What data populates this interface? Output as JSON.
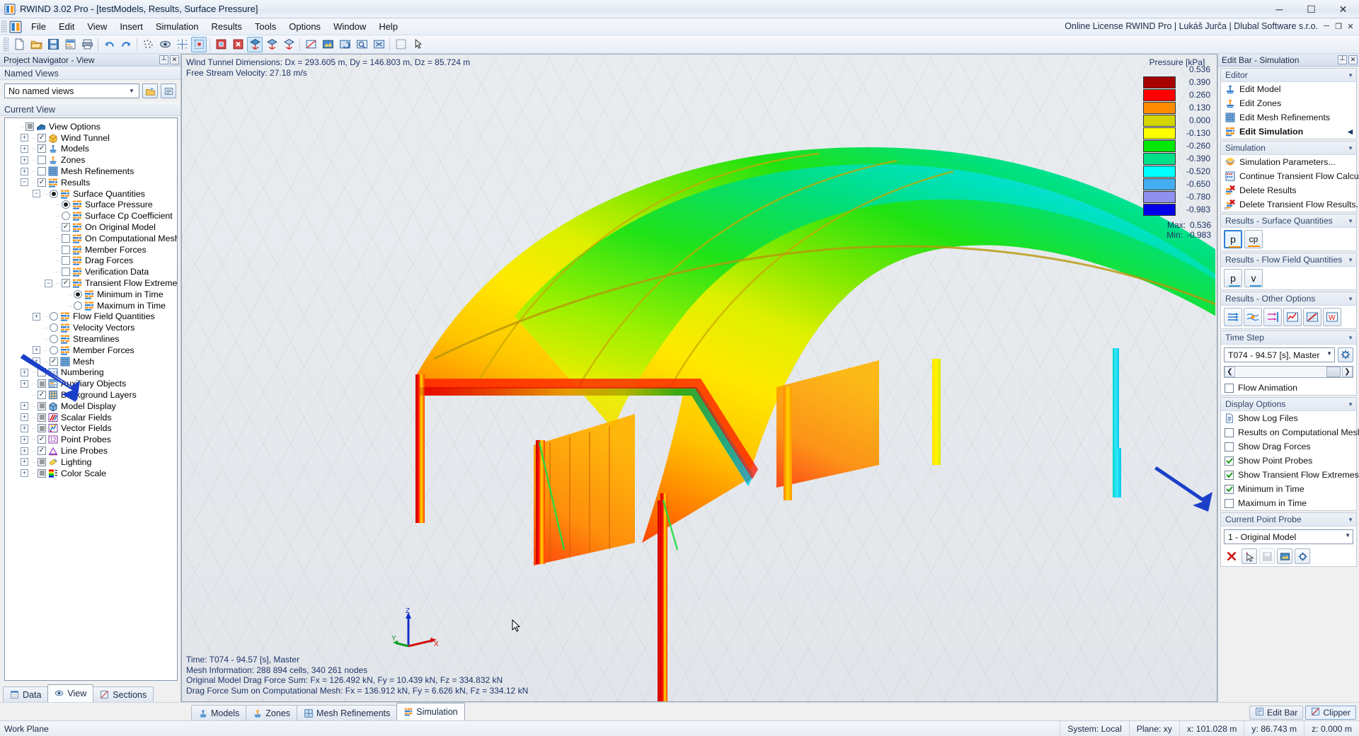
{
  "window": {
    "title": "RWIND 3.02 Pro - [testModels, Results, Surface Pressure]",
    "app_icon": "rwind-icon",
    "minimize": "─",
    "maximize": "☐",
    "close": "✕"
  },
  "menu": {
    "items": [
      "File",
      "Edit",
      "View",
      "Insert",
      "Simulation",
      "Results",
      "Tools",
      "Options",
      "Window",
      "Help"
    ],
    "license": "Online License RWIND Pro | Lukáš Jurča | Dlubal Software s.r.o.",
    "mdi_buttons": [
      "─",
      "❐",
      "✕"
    ]
  },
  "toolbar": {
    "groups": [
      [
        "new-file-icon",
        "open-folder-icon",
        "save-icon",
        "report-icon",
        "print-icon"
      ],
      [
        "undo-icon",
        "redo-icon"
      ],
      [
        "mesh-dots-icon",
        "eye-mesh-icon",
        "snap-grid-icon",
        "select-box-icon"
      ],
      [
        "render-solid-icon",
        "render-x-icon",
        "view-iso1-icon",
        "view-iso2-icon",
        "view-iso3-icon"
      ],
      [
        "view-free-icon",
        "color-render-icon",
        "view-rotate-icon",
        "zoom-window-icon",
        "zoom-fit-icon"
      ],
      [
        "print-area-icon",
        "select-tool-icon"
      ]
    ]
  },
  "left_panel": {
    "header": "Project Navigator - View",
    "header_buttons": [
      "pin-icon",
      "close-icon"
    ],
    "named_views_group": "Named Views",
    "named_views_value": "No named views",
    "named_views_buttons": [
      "save-view-icon",
      "manage-view-icon"
    ],
    "current_view_group": "Current View",
    "tree": [
      {
        "label": "View Options",
        "depth": 0,
        "toggle": "checkbox-gray",
        "expander": "none",
        "icon": "view-options-icon"
      },
      {
        "label": "Wind Tunnel",
        "depth": 1,
        "toggle": "checkbox-checked",
        "expander": "plus",
        "icon": "wind-tunnel-icon"
      },
      {
        "label": "Models",
        "depth": 1,
        "toggle": "checkbox-checked",
        "expander": "plus",
        "icon": "model-icon"
      },
      {
        "label": "Zones",
        "depth": 1,
        "toggle": "checkbox-empty",
        "expander": "plus",
        "icon": "zones-icon"
      },
      {
        "label": "Mesh Refinements",
        "depth": 1,
        "toggle": "checkbox-empty",
        "expander": "plus",
        "icon": "mesh-icon"
      },
      {
        "label": "Results",
        "depth": 1,
        "toggle": "checkbox-checked",
        "expander": "minus",
        "icon": "results-icon"
      },
      {
        "label": "Surface Quantities",
        "depth": 2,
        "toggle": "radio-on",
        "expander": "minus",
        "icon": "results-icon"
      },
      {
        "label": "Surface Pressure",
        "depth": 3,
        "toggle": "radio-on",
        "expander": "none",
        "icon": "results-icon"
      },
      {
        "label": "Surface Cp Coefficient",
        "depth": 3,
        "toggle": "radio-off",
        "expander": "none",
        "icon": "results-icon"
      },
      {
        "label": "On Original Model",
        "depth": 3,
        "toggle": "checkbox-checked",
        "expander": "none",
        "icon": "results-icon"
      },
      {
        "label": "On Computational Mesh",
        "depth": 3,
        "toggle": "checkbox-empty",
        "expander": "none",
        "icon": "results-icon"
      },
      {
        "label": "Member Forces",
        "depth": 3,
        "toggle": "checkbox-empty",
        "expander": "none",
        "icon": "results-icon"
      },
      {
        "label": "Drag Forces",
        "depth": 3,
        "toggle": "checkbox-empty",
        "expander": "none",
        "icon": "results-icon"
      },
      {
        "label": "Verification Data",
        "depth": 3,
        "toggle": "checkbox-empty",
        "expander": "none",
        "icon": "results-icon"
      },
      {
        "label": "Transient Flow Extremes",
        "depth": 3,
        "toggle": "checkbox-checked",
        "expander": "minus",
        "icon": "results-icon"
      },
      {
        "label": "Minimum in Time",
        "depth": 4,
        "toggle": "radio-on",
        "expander": "none",
        "icon": "results-icon"
      },
      {
        "label": "Maximum in Time",
        "depth": 4,
        "toggle": "radio-off",
        "expander": "none",
        "icon": "results-icon"
      },
      {
        "label": "Flow Field Quantities",
        "depth": 2,
        "toggle": "radio-off",
        "expander": "plus",
        "icon": "results-icon"
      },
      {
        "label": "Velocity Vectors",
        "depth": 2,
        "toggle": "radio-off",
        "expander": "none",
        "icon": "results-icon"
      },
      {
        "label": "Streamlines",
        "depth": 2,
        "toggle": "radio-off",
        "expander": "none",
        "icon": "results-icon"
      },
      {
        "label": "Member Forces",
        "depth": 2,
        "toggle": "radio-off",
        "expander": "plus",
        "icon": "results-icon"
      },
      {
        "label": "Mesh",
        "depth": 2,
        "toggle": "checkbox-checked",
        "expander": "plus",
        "icon": "mesh-icon"
      },
      {
        "label": "Numbering",
        "depth": 1,
        "toggle": "checkbox-empty",
        "expander": "plus",
        "icon": "numbering-icon"
      },
      {
        "label": "Auxiliary Objects",
        "depth": 1,
        "toggle": "checkbox-gray",
        "expander": "plus",
        "icon": "auxiliary-icon"
      },
      {
        "label": "Background Layers",
        "depth": 1,
        "toggle": "checkbox-checked",
        "expander": "none",
        "icon": "background-layers-icon"
      },
      {
        "label": "Model Display",
        "depth": 1,
        "toggle": "checkbox-gray",
        "expander": "plus",
        "icon": "model-display-icon"
      },
      {
        "label": "Scalar Fields",
        "depth": 1,
        "toggle": "checkbox-gray",
        "expander": "plus",
        "icon": "scalar-fields-icon"
      },
      {
        "label": "Vector Fields",
        "depth": 1,
        "toggle": "checkbox-gray",
        "expander": "plus",
        "icon": "vector-fields-icon"
      },
      {
        "label": "Point Probes",
        "depth": 1,
        "toggle": "checkbox-checked",
        "expander": "plus",
        "icon": "point-probes-icon"
      },
      {
        "label": "Line Probes",
        "depth": 1,
        "toggle": "checkbox-checked",
        "expander": "plus",
        "icon": "line-probes-icon"
      },
      {
        "label": "Lighting",
        "depth": 1,
        "toggle": "checkbox-gray",
        "expander": "plus",
        "icon": "lighting-icon"
      },
      {
        "label": "Color Scale",
        "depth": 1,
        "toggle": "checkbox-gray",
        "expander": "plus",
        "icon": "color-scale-icon"
      }
    ]
  },
  "view": {
    "top_info": [
      "Wind Tunnel Dimensions: Dx = 293.605 m, Dy = 146.803 m, Dz = 85.724 m",
      "Free Stream Velocity: 27.18 m/s"
    ],
    "bottom_info": [
      "Time: T074 - 94.57 [s], Master",
      "Mesh Information: 288 894 cells, 340 261 nodes",
      "Original Model Drag Force Sum: Fx = 126.492 kN, Fy = 10.439 kN, Fz = 334.832 kN",
      "Drag Force Sum on Computational Mesh: Fx = 136.912 kN, Fy = 6.626 kN, Fz = 334.12 kN"
    ],
    "axes": {
      "x": "X",
      "y": "Y",
      "z": "Z"
    }
  },
  "legend": {
    "title": "Pressure [kPa]",
    "values": [
      "0.536",
      "0.390",
      "0.260",
      "0.130",
      "0.000",
      "-0.130",
      "-0.260",
      "-0.390",
      "-0.520",
      "-0.650",
      "-0.780",
      "-0.983"
    ],
    "colors": [
      "#a80000",
      "#fe0000",
      "#ff8c00",
      "#d4d400",
      "#ffff00",
      "#00e800",
      "#00e08a",
      "#00ffff",
      "#45aef0",
      "#8f90ef",
      "#0000e8"
    ],
    "max_label": "Max:",
    "max_value": "0.536",
    "min_label": "Min:",
    "min_value": "-0.983"
  },
  "right_panel": {
    "header": "Edit Bar - Simulation",
    "header_buttons": [
      "pin-icon",
      "close-icon"
    ],
    "sections": [
      {
        "title": "Editor",
        "items": [
          {
            "label": "Edit Model",
            "icon": "model-icon",
            "bold": false
          },
          {
            "label": "Edit Zones",
            "icon": "zones-icon",
            "bold": false
          },
          {
            "label": "Edit Mesh Refinements",
            "icon": "mesh-icon",
            "bold": false
          },
          {
            "label": "Edit Simulation",
            "icon": "results-icon",
            "bold": true
          }
        ]
      },
      {
        "title": "Simulation",
        "items": [
          {
            "label": "Simulation Parameters...",
            "icon": "sim-params-icon",
            "bold": false
          },
          {
            "label": "Continue Transient Flow Calculat...",
            "icon": "continue-calc-icon",
            "bold": false
          },
          {
            "label": "Delete Results",
            "icon": "delete-results-icon",
            "bold": false
          },
          {
            "label": "Delete Transient Flow Results...",
            "icon": "delete-transient-icon",
            "bold": false
          }
        ]
      }
    ],
    "results_surface": {
      "title": "Results - Surface Quantities",
      "buttons": [
        {
          "label": "p",
          "selected": true,
          "underline": "#ff8c00"
        },
        {
          "label": "cp",
          "selected": false,
          "underline": "#ff8c00"
        }
      ]
    },
    "results_flow": {
      "title": "Results - Flow Field Quantities",
      "buttons": [
        {
          "label": "p",
          "selected": false,
          "underline": "#3a9bd9"
        },
        {
          "label": "v",
          "selected": false,
          "underline": "#3a9bd9"
        }
      ]
    },
    "results_other": {
      "title": "Results - Other Options",
      "buttons": [
        "flow-vectors-icon",
        "streamlines-icon",
        "section-plane-icon",
        "graph-icon",
        "diagram-icon",
        "wind-profile-icon"
      ]
    },
    "time_step": {
      "title": "Time Step",
      "value": "T074 - 94.57 [s], Master",
      "settings_icon": "gear-icon",
      "prev": "❮",
      "next": "❯",
      "flow_animation": {
        "label": "Flow Animation",
        "checked": false
      }
    },
    "display_options": {
      "title": "Display Options",
      "items": [
        {
          "label": "Show Log Files",
          "type": "doc-icon",
          "checked": false
        },
        {
          "label": "Results on Computational Mesh",
          "type": "checkbox",
          "checked": false
        },
        {
          "label": "Show Drag Forces",
          "type": "checkbox",
          "checked": false
        },
        {
          "label": "Show Point Probes",
          "type": "checkbox",
          "checked": true
        },
        {
          "label": "Show Transient Flow Extremes",
          "type": "checkbox",
          "checked": true
        },
        {
          "label": "Minimum in Time",
          "type": "checkbox",
          "checked": true
        },
        {
          "label": "Maximum in Time",
          "type": "checkbox",
          "checked": false
        }
      ]
    },
    "current_point_probe": {
      "title": "Current Point Probe",
      "value": "1 - Original Model",
      "buttons": [
        "delete-red-x-icon",
        "pick-cursor-icon",
        "save-disabled-icon",
        "render-probe-icon",
        "probe-settings-icon"
      ]
    }
  },
  "bottom_tabs": {
    "tabs": [
      {
        "label": "Models",
        "icon": "model-icon",
        "active": false
      },
      {
        "label": "Zones",
        "icon": "zones-icon",
        "active": false
      },
      {
        "label": "Mesh Refinements",
        "icon": "mesh-icon",
        "active": false
      },
      {
        "label": "Simulation",
        "icon": "results-icon",
        "active": true
      }
    ],
    "right_tabs": [
      {
        "label": "Edit Bar",
        "icon": "editbar-icon",
        "active": false
      },
      {
        "label": "Clipper",
        "icon": "clipper-icon",
        "active": true
      }
    ]
  },
  "left_tabs": [
    {
      "label": "Data",
      "icon": "data-icon",
      "active": false
    },
    {
      "label": "View",
      "icon": "view-icon",
      "active": true
    },
    {
      "label": "Sections",
      "icon": "sections-icon",
      "active": false
    }
  ],
  "statusbar": {
    "work_plane": "Work Plane",
    "system": "System: Local",
    "plane": "Plane: xy",
    "x": "x: 101.028 m",
    "y": "y: 86.743 m",
    "z": "z: 0.000 m"
  },
  "colors": {
    "accent": "#2f7fd0",
    "arrow_blue": "#1b3fc8",
    "info_text": "#20346b"
  }
}
